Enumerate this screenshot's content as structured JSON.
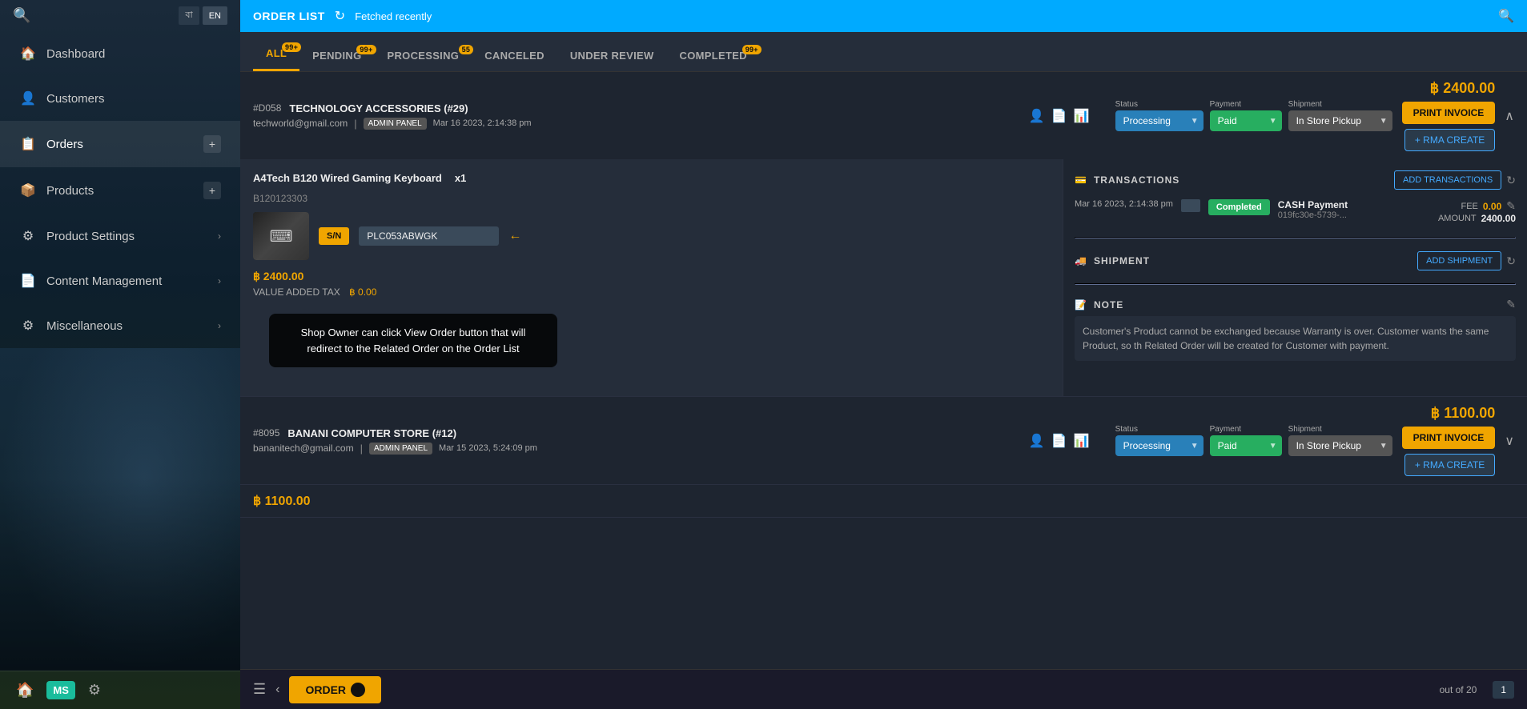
{
  "topBar": {
    "title": "ORDER LIST",
    "fetchedText": "Fetched recently"
  },
  "tabs": [
    {
      "id": "all",
      "label": "ALL",
      "badge": "99+",
      "active": true
    },
    {
      "id": "pending",
      "label": "PENDING",
      "badge": "99+",
      "active": false
    },
    {
      "id": "processing",
      "label": "PROCESSING",
      "badge": "55",
      "active": false
    },
    {
      "id": "canceled",
      "label": "CANCELED",
      "badge": "",
      "active": false
    },
    {
      "id": "underreview",
      "label": "UNDER REVIEW",
      "badge": "",
      "active": false
    },
    {
      "id": "completed",
      "label": "COMPLETED",
      "badge": "99+",
      "active": false
    }
  ],
  "orders": [
    {
      "id": "#D058",
      "name": "TECHNOLOGY ACCESSORIES (#29)",
      "email": "techworld@gmail.com",
      "panel": "ADMIN PANEL",
      "date": "Mar 16 2023, 2:14:38 pm",
      "status": "Processing",
      "payment": "Paid",
      "shipment": "In Store Pickup",
      "total": "฿ 2400.00",
      "expanded": true,
      "product": {
        "name": "A4Tech B120 Wired Gaming Keyboard",
        "sku": "B120123303",
        "qty": "x1",
        "serial": "PLC053ABWGK",
        "price": "฿ 2400.00",
        "vatLabel": "VALUE ADDED TAX",
        "vatAmount": "฿ 0.00"
      },
      "transactions": {
        "title": "TRANSACTIONS",
        "addBtn": "ADD TRANSACTIONS",
        "date": "Mar 16 2023, 2:14:38 pm",
        "status": "Completed",
        "type": "CASH Payment",
        "refId": "019fc30e-5739-...",
        "feeLabel": "FEE",
        "feeAmount": "0.00",
        "amountLabel": "AMOUNT",
        "amountValue": "2400.00"
      },
      "shipmentSection": {
        "title": "SHIPMENT",
        "addBtn": "ADD SHIPMENT"
      },
      "note": {
        "title": "NOTE",
        "text": "Customer's Product cannot be exchanged because Warranty is over. Customer wants the same Product, so th Related Order will be created for Customer with payment."
      }
    },
    {
      "id": "#8095",
      "name": "BANANI COMPUTER STORE (#12)",
      "email": "bananitech@gmail.com",
      "panel": "ADMIN PANEL",
      "date": "Mar 15 2023, 5:24:09 pm",
      "status": "Processing",
      "payment": "Paid",
      "shipment": "In Store Pickup",
      "total": "฿ 1100.00",
      "expanded": false
    }
  ],
  "tooltip": {
    "text": "Shop Owner can click View Order button that will redirect to the Related Order on the Order List"
  },
  "sidebar": {
    "items": [
      {
        "id": "dashboard",
        "label": "Dashboard",
        "icon": "🏠"
      },
      {
        "id": "customers",
        "label": "Customers",
        "icon": "👤"
      },
      {
        "id": "orders",
        "label": "Orders",
        "icon": "📋",
        "active": true
      },
      {
        "id": "products",
        "label": "Products",
        "icon": "📦"
      },
      {
        "id": "product-settings",
        "label": "Product Settings",
        "icon": "⚙"
      },
      {
        "id": "content-management",
        "label": "Content Management",
        "icon": "📄"
      },
      {
        "id": "miscellaneous",
        "label": "Miscellaneous",
        "icon": "⚙"
      }
    ],
    "bottomIcons": {
      "home": "🏠",
      "logo": "MS",
      "settings": "⚙"
    }
  },
  "bottomBar": {
    "orderBtn": "ORDER",
    "pageInfo": "out of 20",
    "pageNum": "1"
  },
  "printInvoice": "PRINT INVOICE",
  "rmaCreate": "+ RMA CREATE",
  "snLabel": "S/N",
  "refreshIcon": "↻"
}
